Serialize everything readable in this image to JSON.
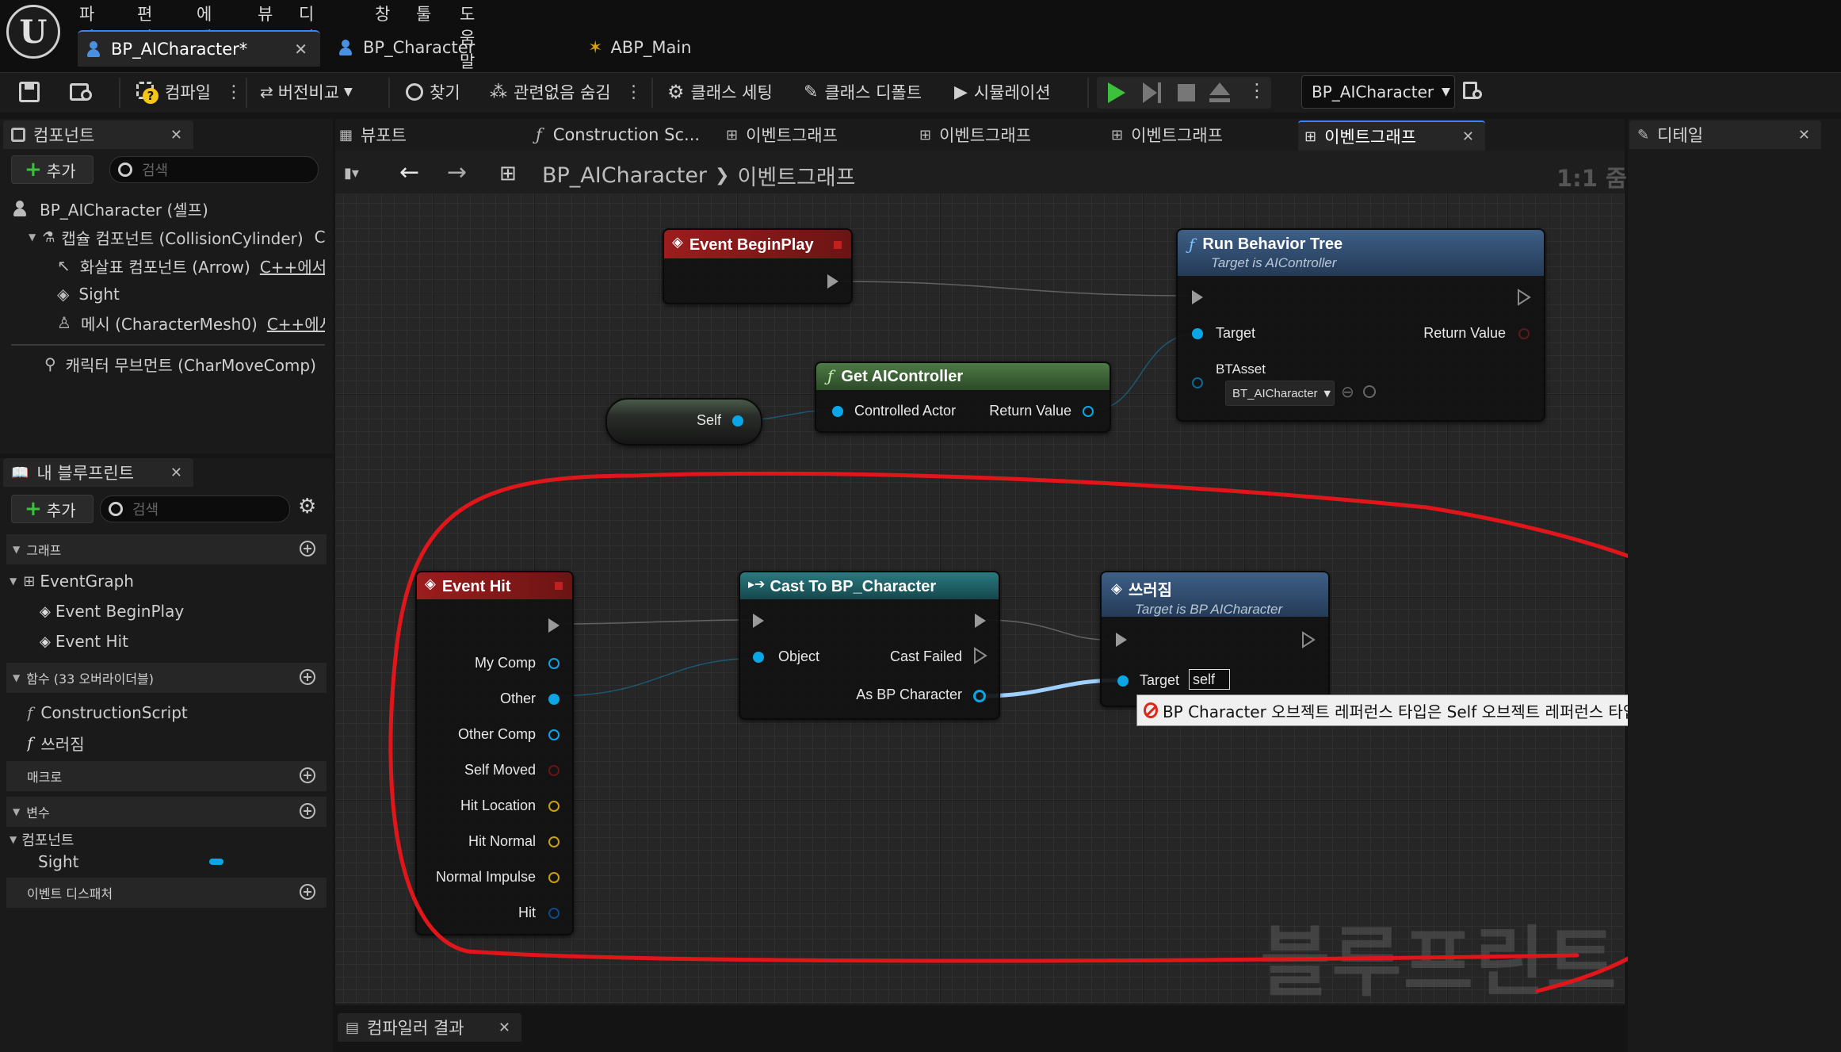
{
  "menu": [
    "파일",
    "편집",
    "에셋",
    "뷰",
    "디버그",
    "창",
    "툴",
    "도움말"
  ],
  "doc_tabs": [
    {
      "label": "BP_AICharacter*",
      "active": true
    },
    {
      "label": "BP_Character",
      "active": false
    },
    {
      "label": "ABP_Main",
      "active": false
    }
  ],
  "toolbar": {
    "compile": "컴파일",
    "diff": "버전비교",
    "find": "찾기",
    "hide_unrelated": "관련없음 숨김",
    "class_settings": "클래스 세팅",
    "class_defaults": "클래스 디폴트",
    "simulation": "시뮬레이션",
    "debug_object": "BP_AICharacter"
  },
  "components_panel": {
    "tab": "컴포넌트",
    "add": "추가",
    "search_placeholder": "검색",
    "items": [
      {
        "label": "BP_AICharacter (셀프)",
        "suffix": ""
      },
      {
        "label": "캡슐 컴포넌트 (CollisionCylinder)",
        "suffix": "C+"
      },
      {
        "label": "화살표 컴포넌트 (Arrow)",
        "suffix": "C++에서"
      },
      {
        "label": "Sight",
        "suffix": ""
      },
      {
        "label": "메시 (CharacterMesh0)",
        "suffix": "C++에서 편"
      },
      {
        "label": "캐릭터 무브먼트 (CharMoveComp)",
        "suffix": "("
      }
    ]
  },
  "my_blueprint": {
    "tab": "내 블루프린트",
    "add": "추가",
    "search_placeholder": "검색",
    "graphs_section": "그래프",
    "event_graph": "EventGraph",
    "event_beginplay": "Event BeginPlay",
    "event_hit": "Event Hit",
    "functions_section": "함수 (33 오버라이더블)",
    "construction_script": "ConstructionScript",
    "fn_fall": "쓰러짐",
    "macros_section": "매크로",
    "variables_section": "변수",
    "var_category": "컴포넌트",
    "var_sight": "Sight",
    "dispatchers_section": "이벤트 디스패처"
  },
  "graph_tabs": [
    "뷰포트",
    "Construction Sc...",
    "이벤트그래프",
    "이벤트그래프",
    "이벤트그래프",
    "이벤트그래프"
  ],
  "graph_header": {
    "breadcrumb_bp": "BP_AICharacter",
    "breadcrumb_graph": "이벤트그래프",
    "zoom": "1:1 줌",
    "watermark": "블루프린트"
  },
  "details": {
    "tab": "디테일"
  },
  "compiler_results": {
    "tab": "컴파일러 결과"
  },
  "nodes": {
    "begin_play": {
      "title": "Event BeginPlay"
    },
    "run_bt": {
      "title": "Run Behavior Tree",
      "subtitle": "Target is AIController",
      "target": "Target",
      "return_value": "Return Value",
      "bt_asset": "BTAsset",
      "bt_asset_value": "BT_AICharacter"
    },
    "get_aicontroller": {
      "title": "Get AIController",
      "controlled_actor": "Controlled Actor",
      "return_value": "Return Value"
    },
    "self_node": {
      "label": "Self"
    },
    "event_hit": {
      "title": "Event Hit",
      "pins": [
        "My Comp",
        "Other",
        "Other Comp",
        "Self Moved",
        "Hit Location",
        "Hit Normal",
        "Normal Impulse",
        "Hit"
      ]
    },
    "cast": {
      "title": "Cast To BP_Character",
      "object": "Object",
      "cast_failed": "Cast Failed",
      "as_bp_character": "As BP Character"
    },
    "fall": {
      "title": "쓰러짐",
      "subtitle": "Target is BP AICharacter",
      "target": "Target",
      "target_value": "self"
    }
  },
  "error_tooltip": "BP Character 오브젝트 레퍼런스 타입은 Self 오브젝트 레퍼런스 타입과 호환되지 않습니다.",
  "colors": {
    "annotation": "#e0161b",
    "exec_event_header": "#8a1a1a",
    "function_header": "#2f4a6e",
    "pure_header": "#3d5a34",
    "cast_header": "#1d5a5e",
    "object_pin": "#0aa6e6",
    "error": "#e0261b"
  }
}
